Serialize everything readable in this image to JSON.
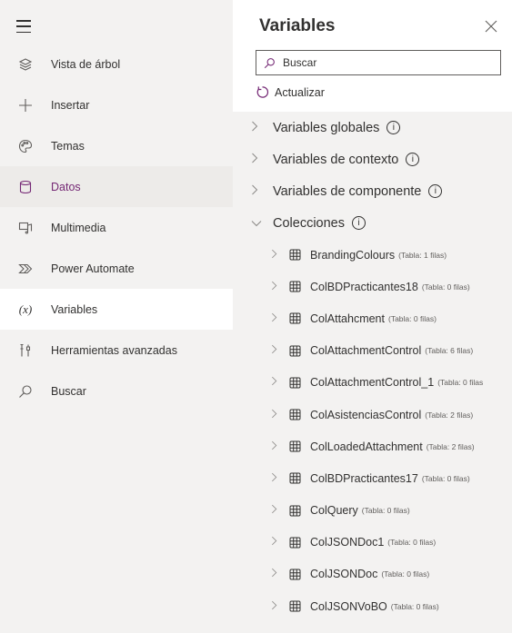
{
  "rail": {
    "items": [
      {
        "label": "Vista de árbol",
        "icon": "layers-icon",
        "name": "rail-item-tree-view"
      },
      {
        "label": "Insertar",
        "icon": "plus-icon",
        "name": "rail-item-insert"
      },
      {
        "label": "Temas",
        "icon": "palette-icon",
        "name": "rail-item-themes"
      },
      {
        "label": "Datos",
        "icon": "database-icon",
        "name": "rail-item-data"
      },
      {
        "label": "Multimedia",
        "icon": "media-icon",
        "name": "rail-item-media"
      },
      {
        "label": "Power Automate",
        "icon": "power-automate-icon",
        "name": "rail-item-power-automate"
      },
      {
        "label": "Variables",
        "icon": "variables-icon",
        "name": "rail-item-variables"
      },
      {
        "label": "Herramientas avanzadas",
        "icon": "tools-icon",
        "name": "rail-item-advanced-tools"
      },
      {
        "label": "Buscar",
        "icon": "search-icon",
        "name": "rail-item-search"
      }
    ],
    "selected": "Datos",
    "current": "Variables"
  },
  "panel": {
    "title": "Variables",
    "search_placeholder": "Buscar",
    "refresh_label": "Actualizar",
    "categories": [
      {
        "label": "Variables globales",
        "expanded": false
      },
      {
        "label": "Variables de contexto",
        "expanded": false
      },
      {
        "label": "Variables de componente",
        "expanded": false
      },
      {
        "label": "Colecciones",
        "expanded": true
      }
    ],
    "collections": [
      {
        "name": "BrandingColours",
        "meta": "(Tabla: 1 filas)"
      },
      {
        "name": "ColBDPracticantes18",
        "meta": "(Tabla: 0 filas)"
      },
      {
        "name": "ColAttahcment",
        "meta": "(Tabla: 0 filas)"
      },
      {
        "name": "ColAttachmentControl",
        "meta": "(Tabla: 6 filas)"
      },
      {
        "name": "ColAttachmentControl_1",
        "meta": "(Tabla: 0 filas"
      },
      {
        "name": "ColAsistenciasControl",
        "meta": "(Tabla: 2 filas)"
      },
      {
        "name": "ColLoadedAttachment",
        "meta": "(Tabla: 2 filas)"
      },
      {
        "name": "ColBDPracticantes17",
        "meta": "(Tabla: 0 filas)"
      },
      {
        "name": "ColQuery",
        "meta": "(Tabla: 0 filas)"
      },
      {
        "name": "ColJSONDoc1",
        "meta": "(Tabla: 0 filas)"
      },
      {
        "name": "ColJSONDoc",
        "meta": "(Tabla: 0 filas)"
      },
      {
        "name": "ColJSONVoBO",
        "meta": "(Tabla: 0 filas)"
      }
    ]
  },
  "colors": {
    "accent": "#742774",
    "rail_bg": "#f3f2f1",
    "selected_bg": "#edebe9"
  }
}
